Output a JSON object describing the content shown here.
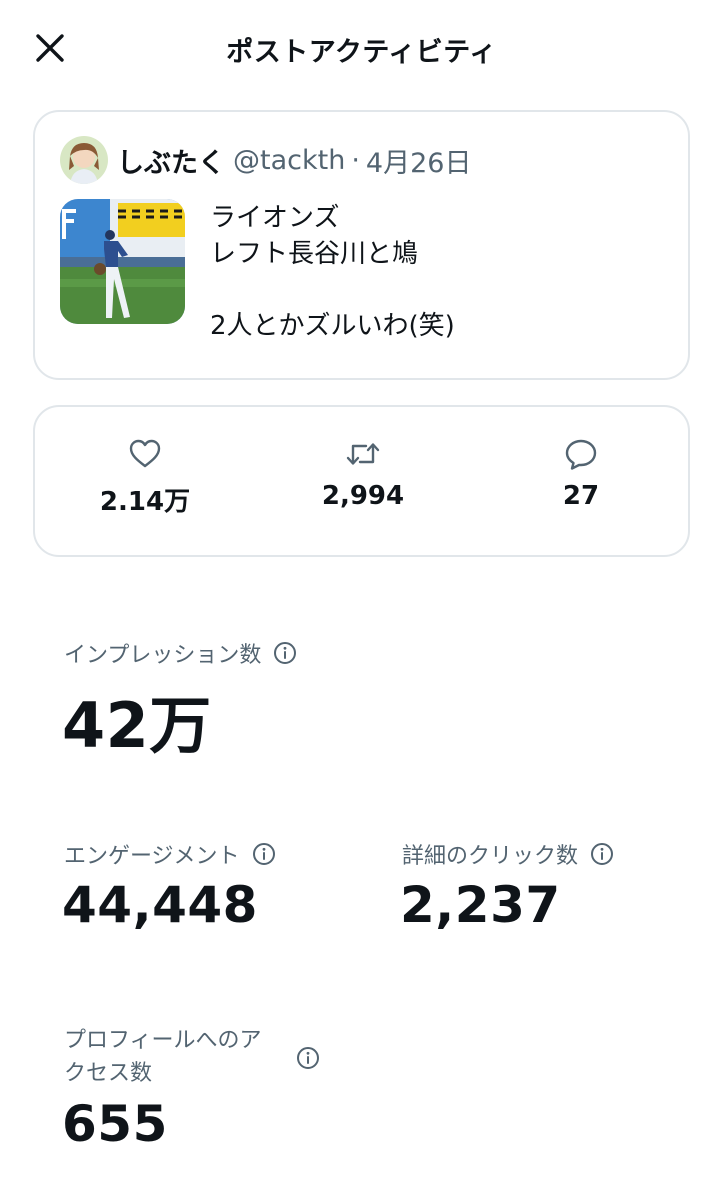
{
  "header": {
    "title": "ポストアクティビティ",
    "close_icon": "close-icon"
  },
  "post": {
    "author_name": "しぶたく",
    "handle": "@tackth",
    "separator": "·",
    "date": "4月26日",
    "text_lines": [
      "ライオンズ",
      "レフト長谷川と鳩",
      "",
      "2人とかズルいわ(笑)"
    ]
  },
  "engagement": {
    "likes": "2.14万",
    "retweets": "2,994",
    "replies": "27",
    "like_icon": "heart-icon",
    "retweet_icon": "retweet-icon",
    "reply_icon": "reply-icon"
  },
  "metrics": {
    "impressions": {
      "label": "インプレッション数",
      "value": "42万"
    },
    "engagements": {
      "label": "エンゲージメント",
      "value": "44,448"
    },
    "detail_clicks": {
      "label": "詳細のクリック数",
      "value": "2,237"
    },
    "profile_visits": {
      "label": "プロフィールへのアクセス数",
      "value": "655"
    }
  },
  "colors": {
    "text_primary": "#0f1419",
    "text_secondary": "#536471",
    "border": "#e1e6ea"
  }
}
